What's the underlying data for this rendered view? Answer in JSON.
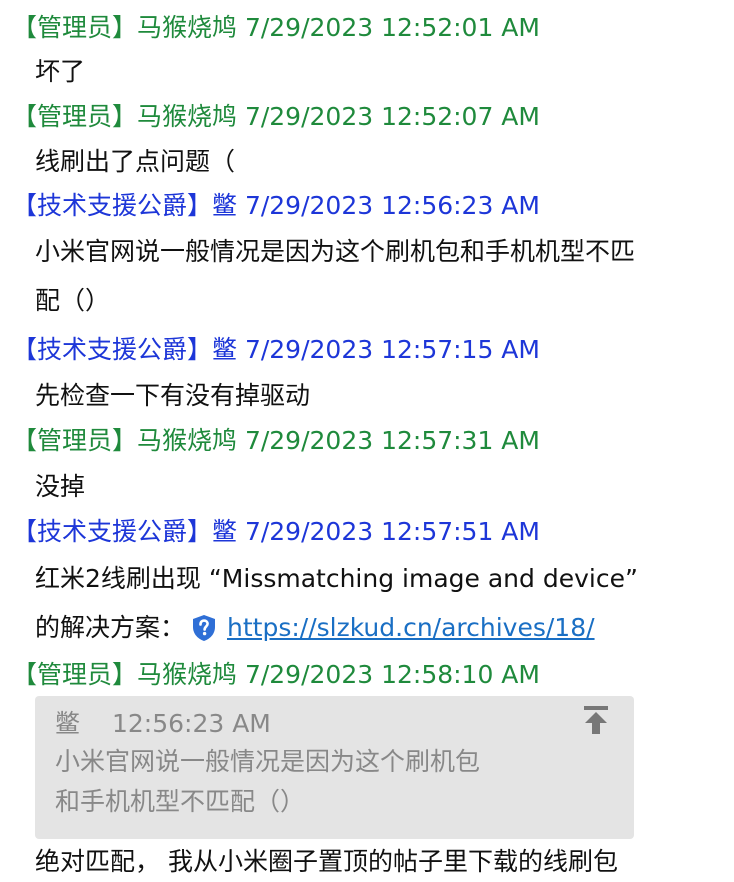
{
  "colors": {
    "admin": "#1f8a3c",
    "tech": "#1d36d8",
    "link": "#1a6fc4",
    "quote_bg": "#e4e4e4",
    "quote_text": "#888888"
  },
  "messages": [
    {
      "header": "【管理员】马猴烧鸠 7/29/2023 12:52:01 AM",
      "lines": [
        "坏了"
      ]
    },
    {
      "header": "【管理员】马猴烧鸠 7/29/2023 12:52:07 AM",
      "lines": [
        "线刷出了点问题（"
      ]
    },
    {
      "header": "【技术支援公爵】鳖 7/29/2023 12:56:23 AM",
      "lines": [
        "小米官网说一般情况是因为这个刷机包和手机机型不匹",
        "配（）"
      ]
    },
    {
      "header": "【技术支援公爵】鳖 7/29/2023 12:57:15 AM",
      "lines": [
        "先检查一下有没有掉驱动"
      ]
    },
    {
      "header": "【管理员】马猴烧鸠 7/29/2023 12:57:31 AM",
      "lines": [
        "没掉"
      ]
    },
    {
      "header": "【技术支援公爵】鳖 7/29/2023 12:57:51 AM",
      "lines": [
        "红米2线刷出现 “Missmatching image and device”"
      ],
      "link_prefix": "的解决方案：",
      "link_text": "https://slzkud.cn/archives/18/",
      "link_icon": "shield-question-icon"
    },
    {
      "header": "【管理员】马猴烧鸠 7/29/2023 12:58:10 AM",
      "lines": [
        "绝对匹配， 我从小米圈子置顶的帖子里下载的线刷包"
      ]
    }
  ],
  "quote": {
    "name": "鳖",
    "time": "12:56:23 AM",
    "lines": [
      "小米官网说一般情况是因为这个刷机包",
      "和手机机型不匹配（）"
    ],
    "icon": "jump-to-top-icon"
  }
}
